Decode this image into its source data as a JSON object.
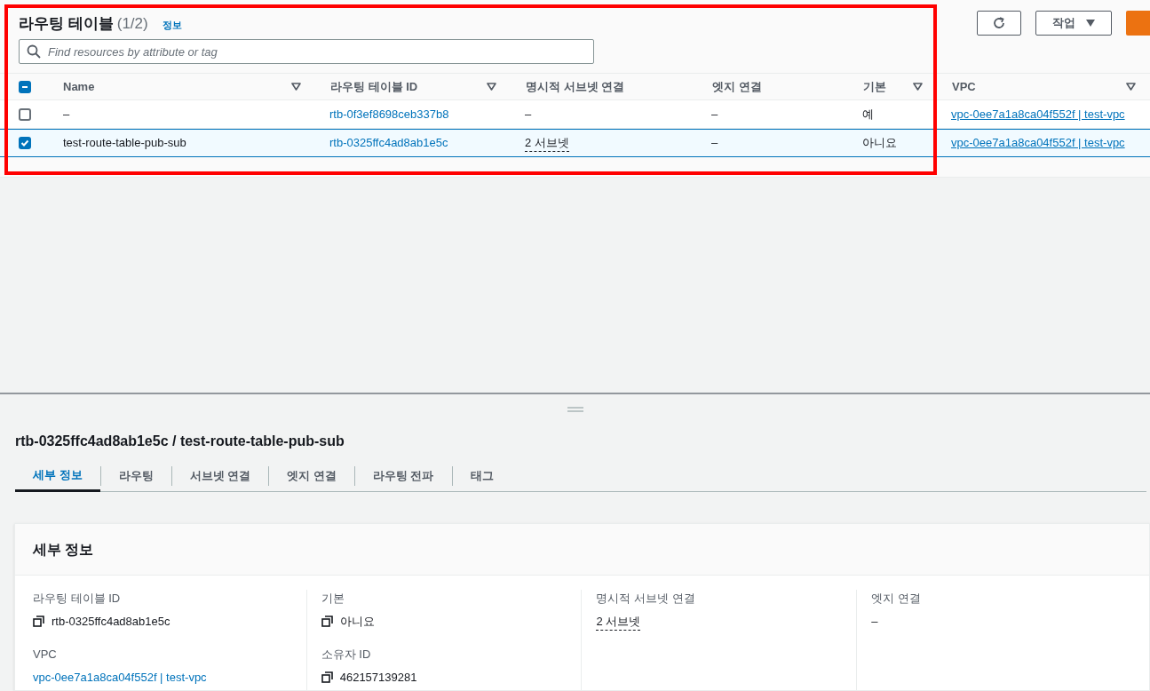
{
  "header": {
    "title": "라우팅 테이블",
    "count": "(1/2)",
    "info_link": "정보",
    "actions": [
      {
        "kind": "refresh"
      },
      {
        "kind": "dropdown",
        "label": "작업"
      },
      {
        "kind": "primary"
      }
    ]
  },
  "search": {
    "placeholder": "Find resources by attribute or tag"
  },
  "table": {
    "select_all": {
      "indeterminate": true
    },
    "columns": [
      {
        "label": "Name",
        "sortable": true,
        "kind": "text"
      },
      {
        "label": "라우팅 테이블 ID",
        "sortable": true,
        "kind": "link"
      },
      {
        "label": "명시적 서브넷 연결",
        "sortable": false,
        "kind": "popover"
      },
      {
        "label": "엣지 연결",
        "sortable": false,
        "kind": "text"
      },
      {
        "label": "기본",
        "sortable": true,
        "kind": "text"
      },
      {
        "label": "VPC",
        "sortable": true,
        "kind": "underlined_link"
      }
    ],
    "rows": [
      {
        "selected": false,
        "cells": [
          "–",
          "rtb-0f3ef8698ceb337b8",
          "–",
          "–",
          "예",
          "vpc-0ee7a1a8ca04f552f | test-vpc"
        ]
      },
      {
        "selected": true,
        "cells": [
          "test-route-table-pub-sub",
          "rtb-0325ffc4ad8ab1e5c",
          "2 서브넷",
          "–",
          "아니요",
          "vpc-0ee7a1a8ca04f552f | test-vpc"
        ]
      }
    ]
  },
  "annotation": {
    "kind": "highlight_frame",
    "color": "#ff0000"
  },
  "detail": {
    "title": "rtb-0325ffc4ad8ab1e5c / test-route-table-pub-sub",
    "tabs": [
      {
        "label": "세부 정보",
        "selected": true
      },
      {
        "label": "라우팅",
        "selected": false
      },
      {
        "label": "서브넷 연결",
        "selected": false
      },
      {
        "label": "엣지 연결",
        "selected": false
      },
      {
        "label": "라우팅 전파",
        "selected": false
      },
      {
        "label": "태그",
        "selected": false
      }
    ],
    "card_title": "세부 정보",
    "columns": [
      [
        {
          "label": "라우팅 테이블 ID",
          "value": "rtb-0325ffc4ad8ab1e5c",
          "kind": "copy"
        },
        {
          "label": "VPC",
          "value": "vpc-0ee7a1a8ca04f552f | test-vpc",
          "kind": "link"
        }
      ],
      [
        {
          "label": "기본",
          "value": "아니요",
          "kind": "copy"
        },
        {
          "label": "소유자 ID",
          "value": "462157139281",
          "kind": "copy"
        }
      ],
      [
        {
          "label": "명시적 서브넷 연결",
          "value": "2 서브넷",
          "kind": "popover"
        }
      ],
      [
        {
          "label": "엣지 연결",
          "value": "–",
          "kind": "text"
        }
      ]
    ]
  }
}
